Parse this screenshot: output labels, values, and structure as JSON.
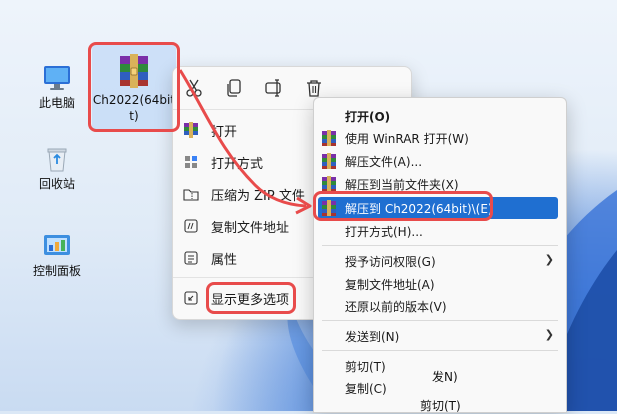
{
  "desktop": {
    "icons": [
      {
        "label": "此电脑",
        "icon": "computer-icon"
      },
      {
        "label": "回收站",
        "icon": "recycle-bin-icon"
      },
      {
        "label": "控制面板",
        "icon": "control-panel-icon"
      }
    ],
    "selected_file": {
      "label_line1": "Ch2022(64bit",
      "label_line2": "t)",
      "icon": "winrar-archive-icon"
    }
  },
  "win11_menu": {
    "toolbar": [
      {
        "name": "cut-icon"
      },
      {
        "name": "copy-icon"
      },
      {
        "name": "rename-icon"
      },
      {
        "name": "delete-icon"
      }
    ],
    "items": [
      {
        "label": "打开",
        "icon": "winrar-icon"
      },
      {
        "label": "打开方式",
        "icon": "open-with-icon"
      },
      {
        "label": "压缩为 ZIP 文件",
        "icon": "zip-folder-icon"
      },
      {
        "label": "复制文件地址",
        "icon": "copy-path-icon"
      },
      {
        "label": "属性",
        "icon": "properties-icon"
      },
      {
        "label": "显示更多选项",
        "icon": "more-options-icon"
      }
    ]
  },
  "classic_menu": {
    "items": [
      {
        "label": "打开(O)",
        "bold": true
      },
      {
        "label": "使用 WinRAR 打开(W)",
        "icon": "winrar-icon"
      },
      {
        "label": "解压文件(A)...",
        "icon": "winrar-icon"
      },
      {
        "label": "解压到当前文件夹(X)",
        "icon": "winrar-icon"
      },
      {
        "label": "解压到 Ch2022(64bit)\\(E)",
        "icon": "winrar-icon",
        "highlighted": true
      },
      {
        "label": "打开方式(H)..."
      },
      {
        "label": "授予访问权限(G)",
        "submenu": true
      },
      {
        "label": "复制文件地址(A)"
      },
      {
        "label": "还原以前的版本(V)"
      },
      {
        "label": "发送到(N)",
        "submenu": true
      },
      {
        "label": "剪切(T)"
      },
      {
        "label": "复制(C)"
      }
    ],
    "stray_texts": [
      "发N)",
      "剪切(T)"
    ]
  },
  "colors": {
    "highlight": "#1f6fd1",
    "callout": "#e84b4b"
  }
}
